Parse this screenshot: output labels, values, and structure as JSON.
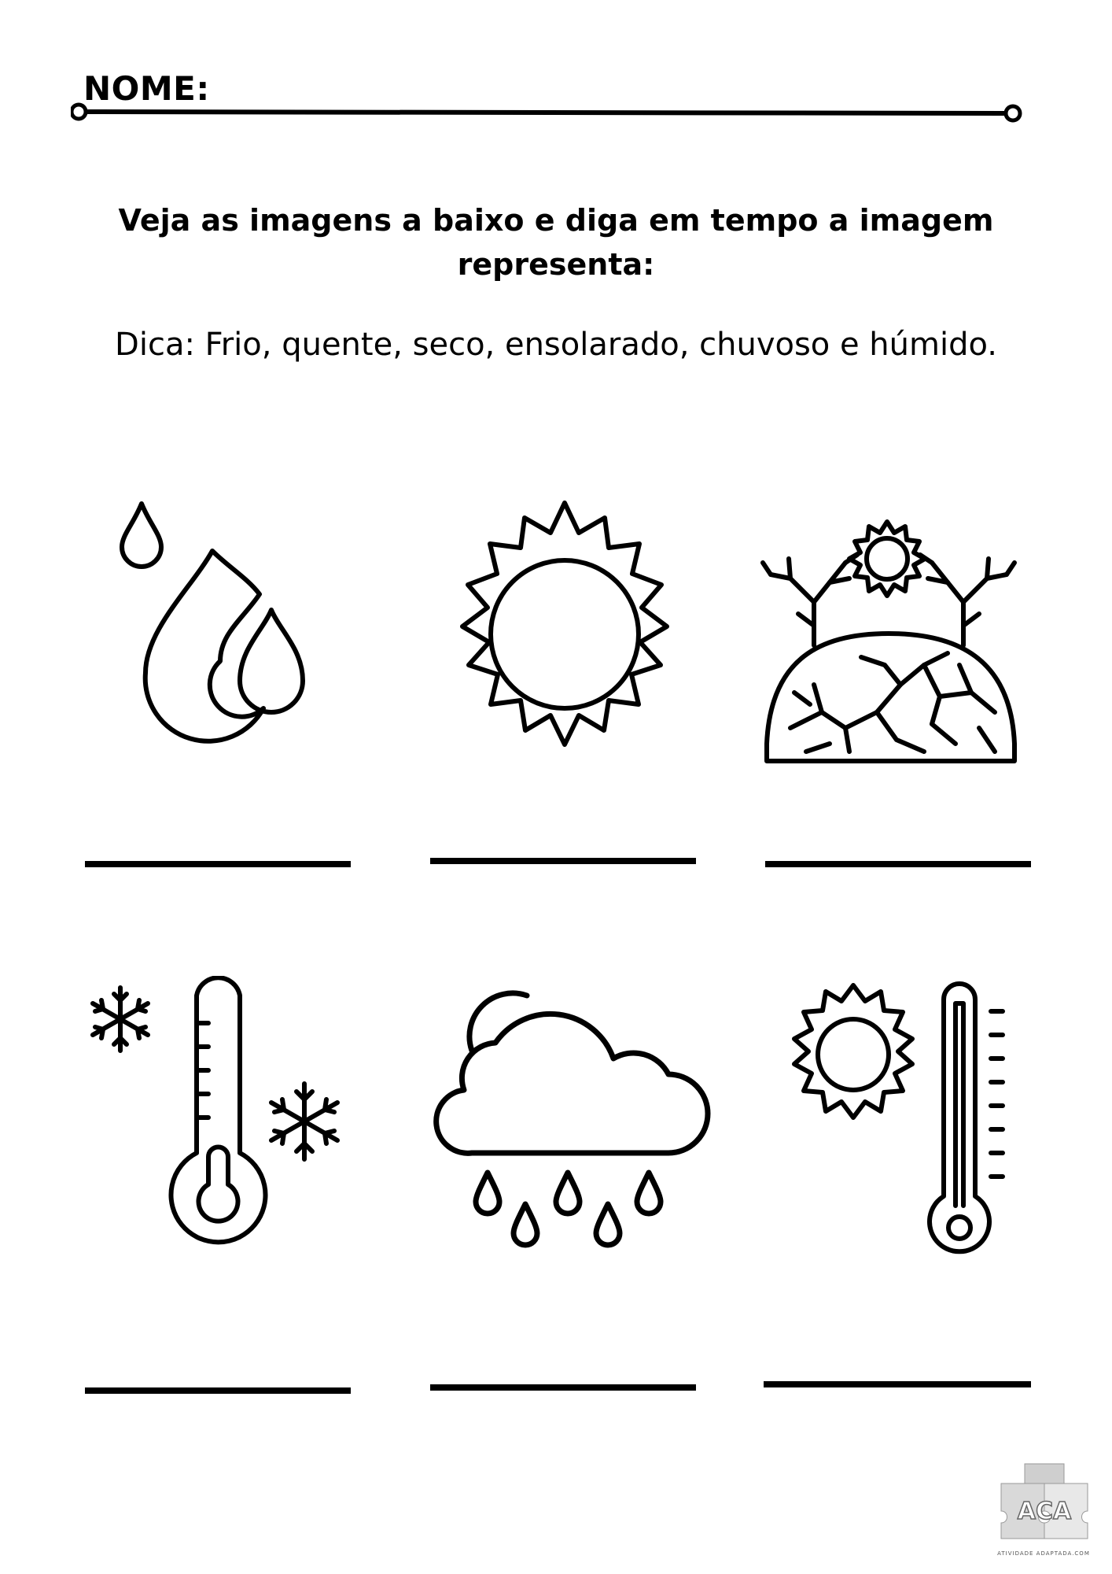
{
  "header": {
    "name_label": "NOME:"
  },
  "instructions": {
    "question": "Veja as imagens a baixo e diga em tempo a imagem representa:",
    "hint": "Dica: Frio, quente, seco, ensolarado, chuvoso e húmido."
  },
  "items": [
    {
      "icon": "water-drops-icon"
    },
    {
      "icon": "sun-icon"
    },
    {
      "icon": "dry-land-icon"
    },
    {
      "icon": "cold-thermometer-icon"
    },
    {
      "icon": "rain-cloud-icon"
    },
    {
      "icon": "hot-thermometer-icon"
    }
  ],
  "logo": {
    "text": "ACA",
    "tagline": "ATIVIDADE ADAPTADA.COM"
  }
}
